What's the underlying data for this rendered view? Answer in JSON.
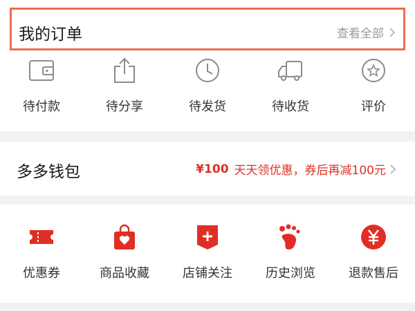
{
  "orders": {
    "title": "我的订单",
    "view_all": "查看全部",
    "items": [
      {
        "label": "待付款",
        "icon": "wallet-icon"
      },
      {
        "label": "待分享",
        "icon": "share-icon"
      },
      {
        "label": "待发货",
        "icon": "clock-icon"
      },
      {
        "label": "待收货",
        "icon": "truck-icon"
      },
      {
        "label": "评价",
        "icon": "star-badge-icon"
      }
    ]
  },
  "wallet": {
    "title": "多多钱包",
    "promo_amount": "¥100",
    "promo_text": "天天领优惠，券后再减100元"
  },
  "services": {
    "items": [
      {
        "label": "优惠券",
        "icon": "coupon-icon"
      },
      {
        "label": "商品收藏",
        "icon": "heart-bag-icon"
      },
      {
        "label": "店铺关注",
        "icon": "store-follow-icon"
      },
      {
        "label": "历史浏览",
        "icon": "footprint-icon"
      },
      {
        "label": "退款售后",
        "icon": "yuan-circle-icon"
      }
    ]
  },
  "colors": {
    "accent": "#e02e24",
    "highlight_border": "#f26a4f",
    "icon_gray": "#8a8a8a"
  }
}
